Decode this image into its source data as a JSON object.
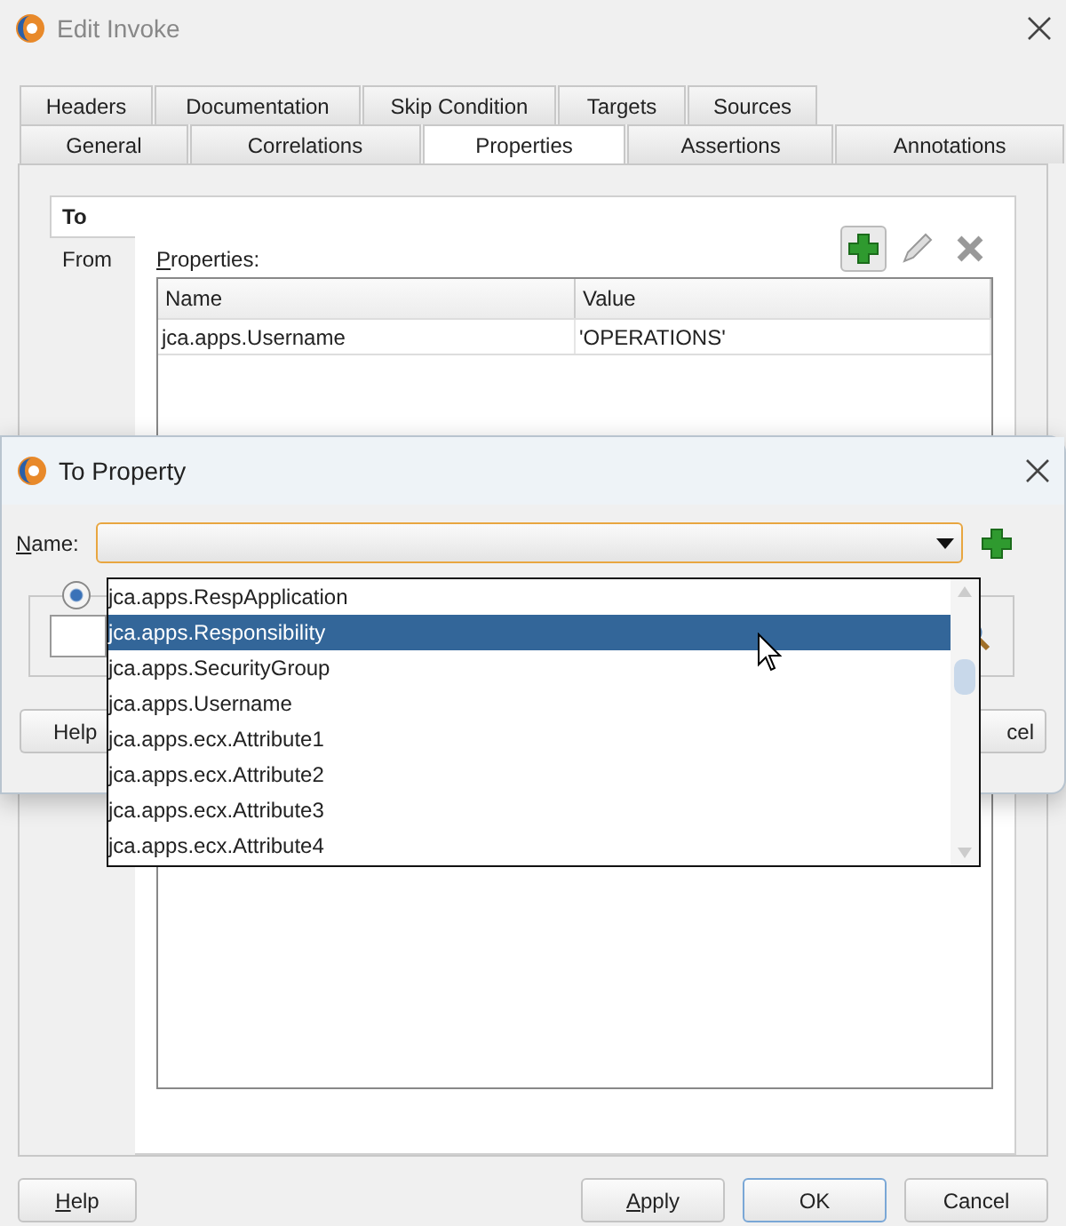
{
  "window": {
    "title": "Edit Invoke"
  },
  "tab_rows": [
    [
      {
        "label": "Headers",
        "selected": false
      },
      {
        "label": "Documentation",
        "selected": false
      },
      {
        "label": "Skip Condition",
        "selected": false
      },
      {
        "label": "Targets",
        "selected": false
      },
      {
        "label": "Sources",
        "selected": false
      }
    ],
    [
      {
        "label": "General",
        "selected": false
      },
      {
        "label": "Correlations",
        "selected": false
      },
      {
        "label": "Properties",
        "selected": true
      },
      {
        "label": "Assertions",
        "selected": false
      },
      {
        "label": "Annotations",
        "selected": false
      }
    ]
  ],
  "side_tabs": [
    {
      "label": "To",
      "selected": true
    },
    {
      "label": "From",
      "selected": false
    }
  ],
  "properties": {
    "label": "Properties:",
    "mnemonic": true,
    "columns": [
      "Name",
      "Value"
    ],
    "rows": [
      [
        "jca.apps.Username",
        "'OPERATIONS'"
      ]
    ]
  },
  "buttons": [
    {
      "label": "Help",
      "mnemonic": true,
      "default": false
    },
    {
      "label": "Apply",
      "mnemonic": true,
      "default": false
    },
    {
      "label": "OK",
      "mnemonic": false,
      "default": true
    },
    {
      "label": "Cancel",
      "mnemonic": false,
      "default": false
    }
  ],
  "dialog": {
    "title": "To Property",
    "name_label": "Name:",
    "radio": {
      "selected": true
    },
    "options": [
      {
        "label": "jca.apps.RespApplication",
        "selected": false
      },
      {
        "label": "jca.apps.Responsibility",
        "selected": true
      },
      {
        "label": "jca.apps.SecurityGroup",
        "selected": false
      },
      {
        "label": "jca.apps.Username",
        "selected": false
      },
      {
        "label": "jca.apps.ecx.Attribute1",
        "selected": false
      },
      {
        "label": "jca.apps.ecx.Attribute2",
        "selected": false
      },
      {
        "label": "jca.apps.ecx.Attribute3",
        "selected": false
      },
      {
        "label": "jca.apps.ecx.Attribute4",
        "selected": false
      }
    ],
    "buttons": [
      {
        "label": "Help"
      },
      {
        "label": "cel"
      }
    ]
  }
}
